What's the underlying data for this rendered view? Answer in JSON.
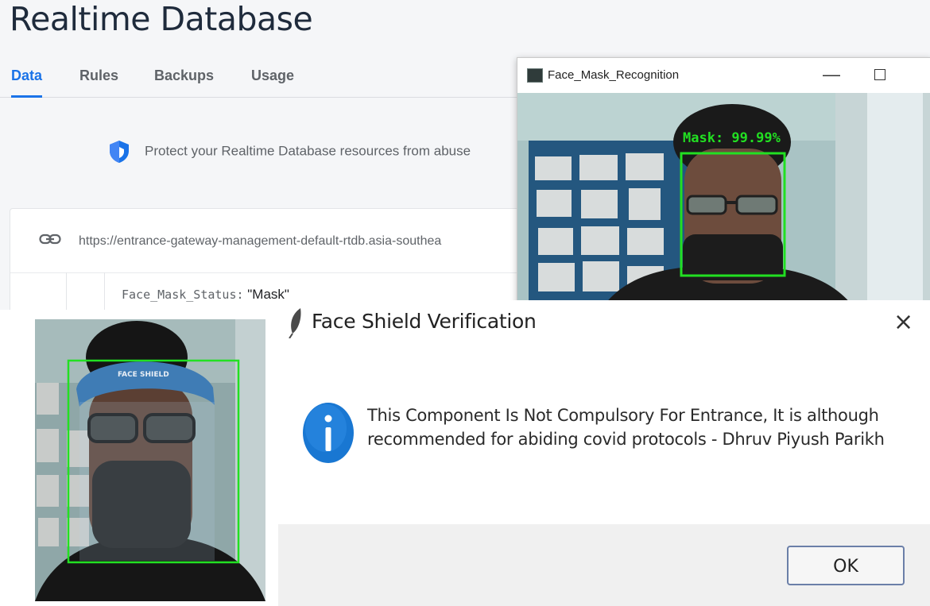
{
  "firebase": {
    "title": "Realtime Database",
    "tabs": [
      {
        "label": "Data",
        "active": true
      },
      {
        "label": "Rules",
        "active": false
      },
      {
        "label": "Backups",
        "active": false
      },
      {
        "label": "Usage",
        "active": false
      }
    ],
    "notice": "Protect your Realtime Database resources from abuse",
    "url": "https://entrance-gateway-management-default-rtdb.asia-southea",
    "node_key": "Face_Mask_Status:",
    "node_value": "\"Mask\"",
    "accent_color": "#1a73e8"
  },
  "mask_window": {
    "title": "Face_Mask_Recognition",
    "label": "Mask: 99.99%",
    "box_color": "#22e022"
  },
  "dialog": {
    "title": "Face Shield Verification",
    "close": "×",
    "message": "This Component Is Not Compulsory For Entrance, It is although recommended for abiding covid protocols - Dhruv Piyush Parikh",
    "ok_label": "OK"
  },
  "shield_camera": {
    "shield_text": "FACE SHIELD",
    "box_color": "#22e022"
  }
}
